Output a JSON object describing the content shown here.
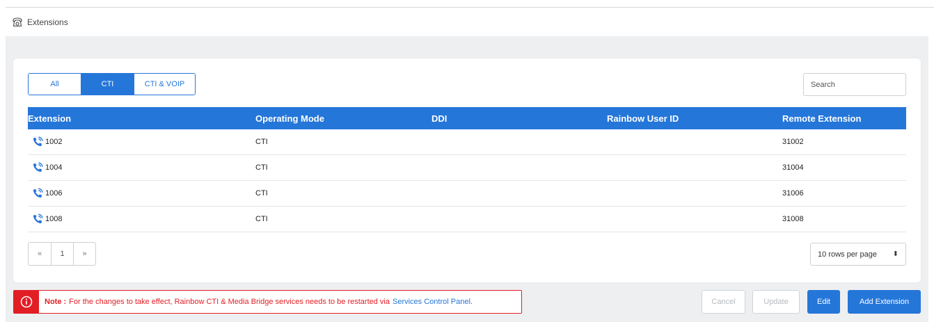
{
  "header": {
    "title": "Extensions",
    "icon": "telephone-icon"
  },
  "filters": [
    {
      "label": "All",
      "active": false
    },
    {
      "label": "CTI",
      "active": true
    },
    {
      "label": "CTI & VOIP",
      "active": false
    }
  ],
  "search": {
    "placeholder": "Search",
    "value": ""
  },
  "table": {
    "columns": [
      "Extension",
      "Operating Mode",
      "DDI",
      "Rainbow User ID",
      "Remote Extension"
    ],
    "rows": [
      {
        "extension": "1002",
        "mode": "CTI",
        "ddi": "",
        "rainbow_id": "",
        "remote": "31002"
      },
      {
        "extension": "1004",
        "mode": "CTI",
        "ddi": "",
        "rainbow_id": "",
        "remote": "31004"
      },
      {
        "extension": "1006",
        "mode": "CTI",
        "ddi": "",
        "rainbow_id": "",
        "remote": "31006"
      },
      {
        "extension": "1008",
        "mode": "CTI",
        "ddi": "",
        "rainbow_id": "",
        "remote": "31008"
      }
    ]
  },
  "pagination": {
    "prev": "«",
    "page": "1",
    "next": "»"
  },
  "rows_per_page": {
    "label": "10 rows per page",
    "caret": "⬍"
  },
  "note": {
    "label": "Note :",
    "text": "For the changes to take effect, Rainbow CTI & Media Bridge services needs to be restarted via",
    "link": "Services Control Panel",
    "suffix": "."
  },
  "actions": {
    "cancel": "Cancel",
    "update": "Update",
    "edit": "Edit",
    "add": "Add Extension"
  },
  "colors": {
    "accent": "#2576d9",
    "danger": "#e21e25",
    "background": "#eeeff1"
  }
}
